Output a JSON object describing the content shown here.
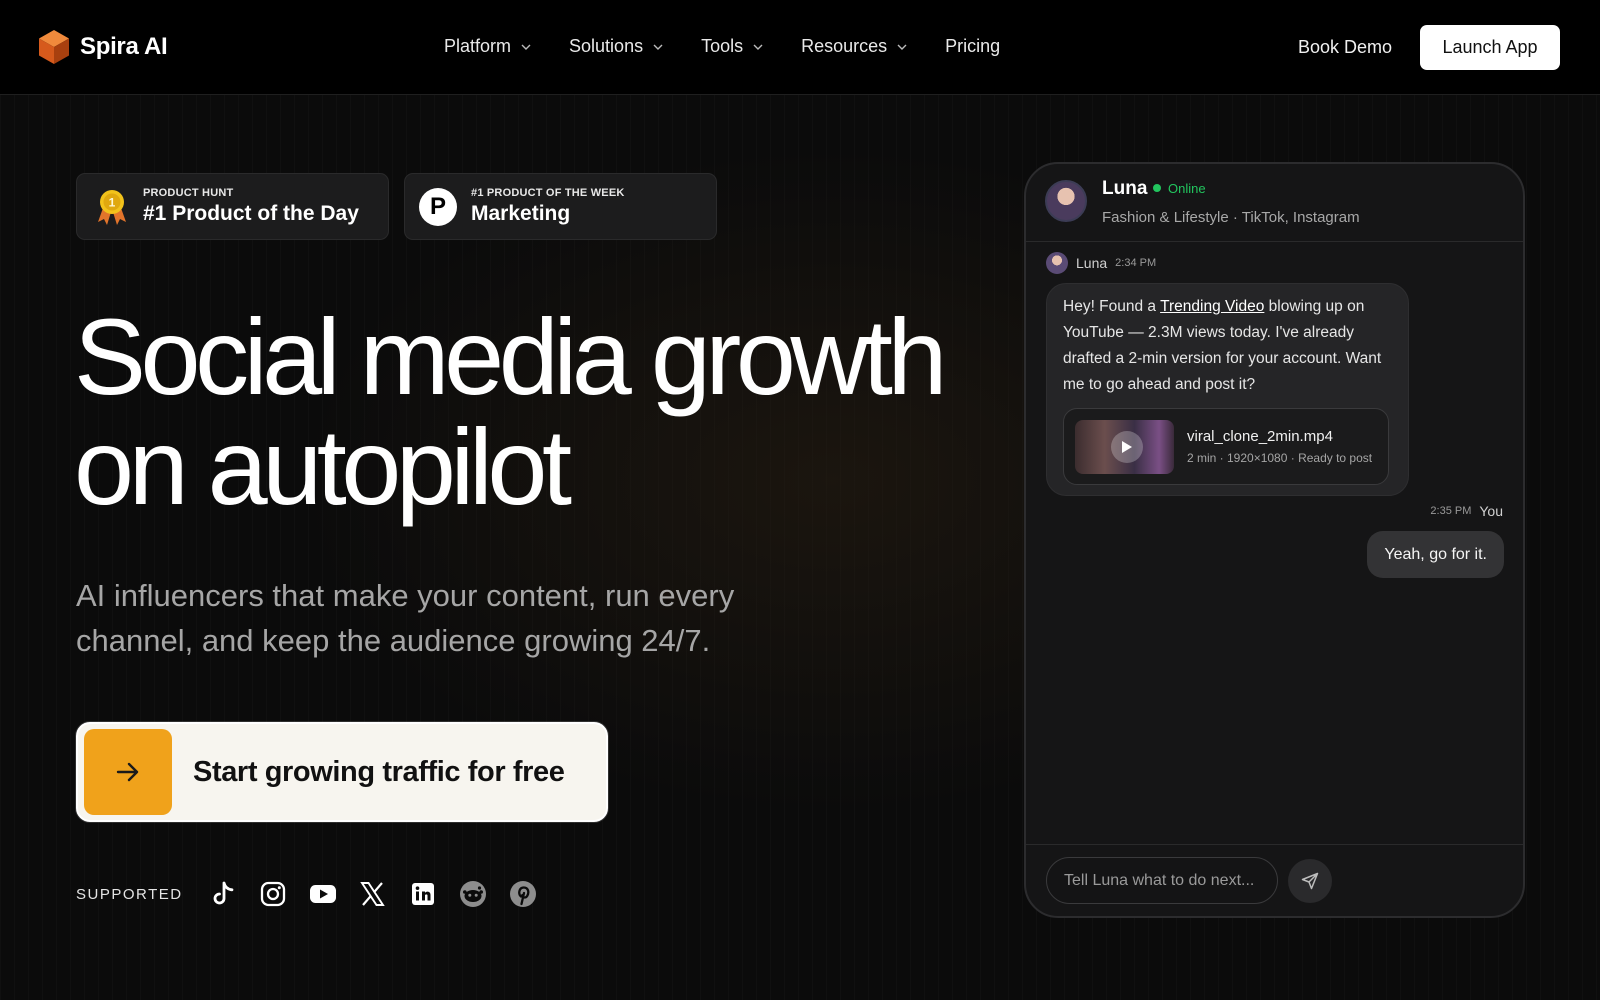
{
  "nav": {
    "brand": "Spira AI",
    "links": [
      {
        "label": "Platform",
        "has_dropdown": true
      },
      {
        "label": "Solutions",
        "has_dropdown": true
      },
      {
        "label": "Tools",
        "has_dropdown": true
      },
      {
        "label": "Resources",
        "has_dropdown": true
      },
      {
        "label": "Pricing",
        "has_dropdown": false
      }
    ],
    "book_demo": "Book Demo",
    "launch_app": "Launch App"
  },
  "badges": [
    {
      "kicker": "PRODUCT HUNT",
      "title": "#1 Product of the Day",
      "icon": "medal-icon"
    },
    {
      "kicker": "#1 PRODUCT OF THE WEEK",
      "title": "Marketing",
      "icon": "product-hunt-icon",
      "icon_letter": "P"
    }
  ],
  "hero": {
    "headline_line1": "Social media growth",
    "headline_line2": "on autopilot",
    "subtitle": "AI influencers that make your content, run every channel, and keep the audience growing 24/7.",
    "cta": "Start growing traffic for free",
    "supported_label": "SUPPORTED",
    "socials": [
      "tiktok-icon",
      "instagram-icon",
      "youtube-icon",
      "x-icon",
      "linkedin-icon",
      "reddit-icon",
      "pinterest-icon"
    ]
  },
  "chat": {
    "agent_name": "Luna",
    "status": "Online",
    "agent_sub": "Fashion & Lifestyle · TikTok, Instagram",
    "msg1": {
      "author": "Luna",
      "time": "2:34 PM",
      "text_before": "Hey! Found a ",
      "link_text": "Trending Video",
      "text_after": " blowing up on YouTube — 2.3M views today. I've already drafted a 2-min version for your account. Want me to go ahead and post it?",
      "attachment": {
        "file_name": "viral_clone_2min.mp4",
        "file_meta": "2 min · 1920×1080 · Ready to post"
      }
    },
    "msg2": {
      "author": "You",
      "time": "2:35 PM",
      "text": "Yeah, go for it."
    },
    "input_placeholder": "Tell Luna what to do next..."
  },
  "colors": {
    "accent": "#f0a21b",
    "online": "#22c55e",
    "background": "#0b0b0b"
  }
}
